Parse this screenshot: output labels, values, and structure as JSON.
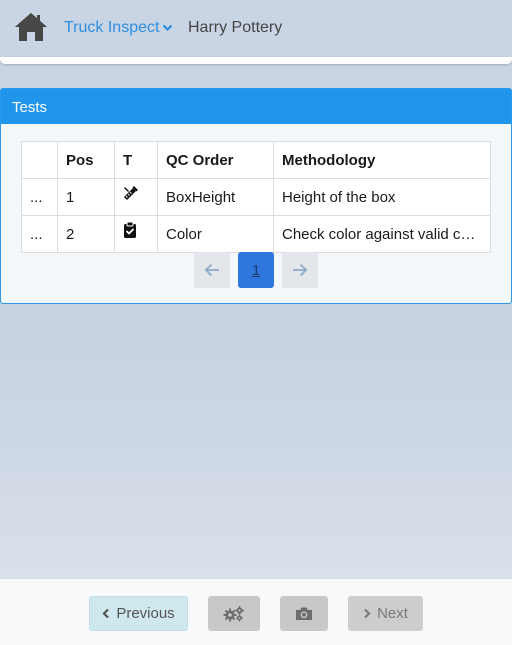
{
  "header": {
    "home_icon": "home-icon",
    "app_title": "Truck Inspect",
    "app_menu_icon": "chevron-down-icon",
    "user_name": "Harry Pottery",
    "accent_color": "#2e8fe0"
  },
  "panel": {
    "title": "Tests",
    "header_color": "#1f96ec",
    "table": {
      "columns": [
        "",
        "Pos",
        "T",
        "QC Order",
        "Methodology"
      ],
      "rows": [
        {
          "menu": "...",
          "pos": "1",
          "type_icon": "ruler-pencil-icon",
          "qc_order": "BoxHeight",
          "methodology": "Height of the box"
        },
        {
          "menu": "...",
          "pos": "2",
          "type_icon": "clipboard-check-icon",
          "qc_order": "Color",
          "methodology": "Check color against valid colors"
        }
      ]
    },
    "pagination": {
      "prev_icon": "arrow-left-icon",
      "current_page": "1",
      "next_icon": "arrow-right-icon"
    }
  },
  "footer": {
    "previous_label": "Previous",
    "previous_icon": "chevron-left-icon",
    "settings_icon": "gears-icon",
    "camera_icon": "camera-icon",
    "next_label": "Next",
    "next_icon": "chevron-right-icon"
  }
}
